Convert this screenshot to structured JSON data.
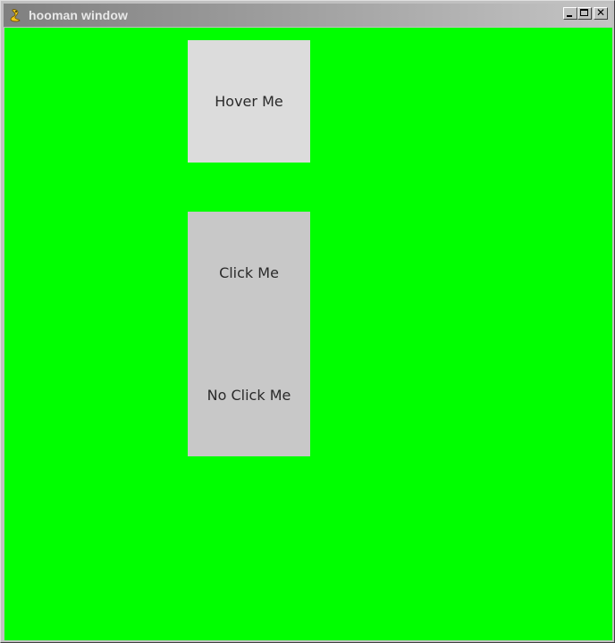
{
  "window": {
    "title": "hooman window",
    "icon": "pygame-snake-icon",
    "controls": {
      "minimize": "minimize-icon",
      "maximize": "maximize-icon",
      "close": "close-icon",
      "close_glyph": "✕"
    }
  },
  "canvas": {
    "background": "#00ff00"
  },
  "buttons": {
    "hover_label": "Hover Me",
    "click_label": "Click Me",
    "noclick_label": "No Click Me"
  }
}
